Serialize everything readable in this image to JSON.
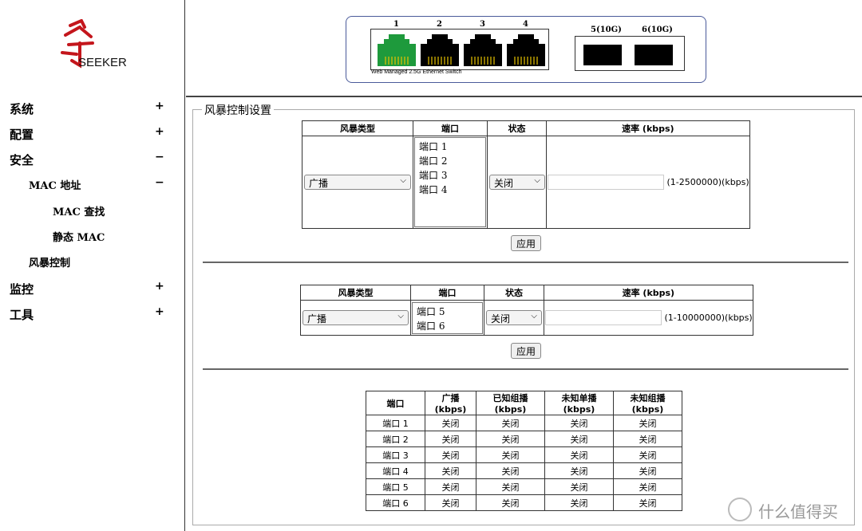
{
  "brand": {
    "name": "SEEKER"
  },
  "menu": [
    {
      "label": "系统",
      "symbol": "+",
      "level": 0
    },
    {
      "label": "配置",
      "symbol": "+",
      "level": 0
    },
    {
      "label": "安全",
      "symbol": "−",
      "level": 0
    },
    {
      "label": "MAC 地址",
      "symbol": "−",
      "level": 1
    },
    {
      "label": "MAC 查找",
      "symbol": "",
      "level": 2
    },
    {
      "label": "静态 MAC",
      "symbol": "",
      "level": 2
    },
    {
      "label": "风暴控制",
      "symbol": "",
      "level": 1
    },
    {
      "label": "监控",
      "symbol": "+",
      "level": 0
    },
    {
      "label": "工具",
      "symbol": "+",
      "level": 0
    }
  ],
  "device": {
    "copper_ports": [
      "1",
      "2",
      "3",
      "4"
    ],
    "sfp_ports": [
      "5(10G)",
      "6(10G)"
    ],
    "label": "Web Managed 2.5G Ethernet Switch",
    "active_port_color": "#1e9a3c"
  },
  "section": {
    "title": "风暴控制设置"
  },
  "headers": {
    "storm_type": "风暴类型",
    "port": "端口",
    "state": "状态",
    "rate": "速率 (kbps)"
  },
  "form1": {
    "storm_type": "广播",
    "ports": [
      "端口 1",
      "端口 2",
      "端口 3",
      "端口 4"
    ],
    "state": "关闭",
    "rate_value": "",
    "range": "(1-2500000)(kbps)",
    "apply": "应用"
  },
  "form2": {
    "storm_type": "广播",
    "ports": [
      "端口 5",
      "端口 6"
    ],
    "state": "关闭",
    "rate_value": "",
    "range": "(1-10000000)(kbps)",
    "apply": "应用"
  },
  "status_table": {
    "columns": [
      "端口",
      "广播 (kbps)",
      "已知组播 (kbps)",
      "未知单播 (kbps)",
      "未知组播 (kbps)"
    ],
    "rows": [
      [
        "端口 1",
        "关闭",
        "关闭",
        "关闭",
        "关闭"
      ],
      [
        "端口 2",
        "关闭",
        "关闭",
        "关闭",
        "关闭"
      ],
      [
        "端口 3",
        "关闭",
        "关闭",
        "关闭",
        "关闭"
      ],
      [
        "端口 4",
        "关闭",
        "关闭",
        "关闭",
        "关闭"
      ],
      [
        "端口 5",
        "关闭",
        "关闭",
        "关闭",
        "关闭"
      ],
      [
        "端口 6",
        "关闭",
        "关闭",
        "关闭",
        "关闭"
      ]
    ]
  },
  "watermark": "什么值得买"
}
